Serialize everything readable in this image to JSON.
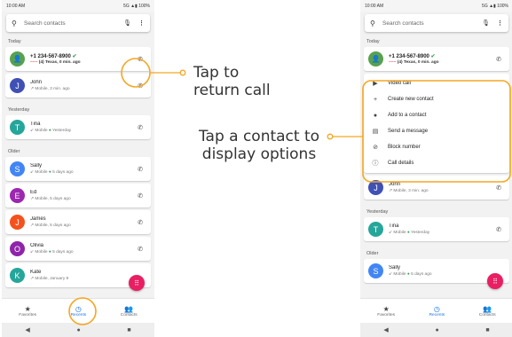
{
  "status": {
    "time": "10:00 AM",
    "network": "5G",
    "battery": "100%"
  },
  "search": {
    "placeholder": "Search contacts"
  },
  "sections": {
    "today": "Today",
    "yesterday": "Yesterday",
    "older": "Older"
  },
  "left_calls": [
    {
      "name": "+1 234-567-8900",
      "detail": "(4) Texas, 0 min. ago",
      "avatar": "person",
      "color": "#57a14f",
      "missed": true
    },
    {
      "name": "John",
      "detail": "Mobile, 3 min. ago",
      "avatar": "J",
      "color": "#3f51b5"
    },
    {
      "name": "Tina",
      "detail": "Mobile",
      "detail_time": "Yesterday",
      "avatar": "T",
      "color": "#26a69a"
    },
    {
      "name": "Sally",
      "detail": "Mobile",
      "detail_time": "5 days ago",
      "avatar": "S",
      "color": "#4285f4"
    },
    {
      "name": "Ed",
      "detail": "Mobile, 5 days ago",
      "avatar": "E",
      "color": "#9c27b0"
    },
    {
      "name": "James",
      "detail": "Mobile, 5 days ago",
      "avatar": "J",
      "color": "#f4511e"
    },
    {
      "name": "Olivia",
      "detail": "Mobile",
      "detail_time": "5 days ago",
      "avatar": "O",
      "color": "#8e24aa"
    },
    {
      "name": "Kate",
      "detail": "Mobile, January 9",
      "avatar": "K",
      "color": "#26a69a"
    }
  ],
  "menu": [
    {
      "label": "Video call",
      "icon": "video-icon"
    },
    {
      "label": "Create new contact",
      "icon": "person-add-icon"
    },
    {
      "label": "Add to a contact",
      "icon": "person-icon"
    },
    {
      "label": "Send a message",
      "icon": "message-icon"
    },
    {
      "label": "Block number",
      "icon": "block-icon"
    },
    {
      "label": "Call details",
      "icon": "info-icon"
    }
  ],
  "nav": {
    "favorites": "Favorites",
    "recents": "Recents",
    "contacts": "Contacts",
    "badge": "3"
  },
  "callouts": {
    "return_call_line1": "Tap to",
    "return_call_line2": "return call",
    "options_line1": "Tap a contact to",
    "options_line2": "display options"
  },
  "colors": {
    "accent": "#f5a623",
    "fab": "#e91e63",
    "nav_active": "#1a73e8"
  }
}
